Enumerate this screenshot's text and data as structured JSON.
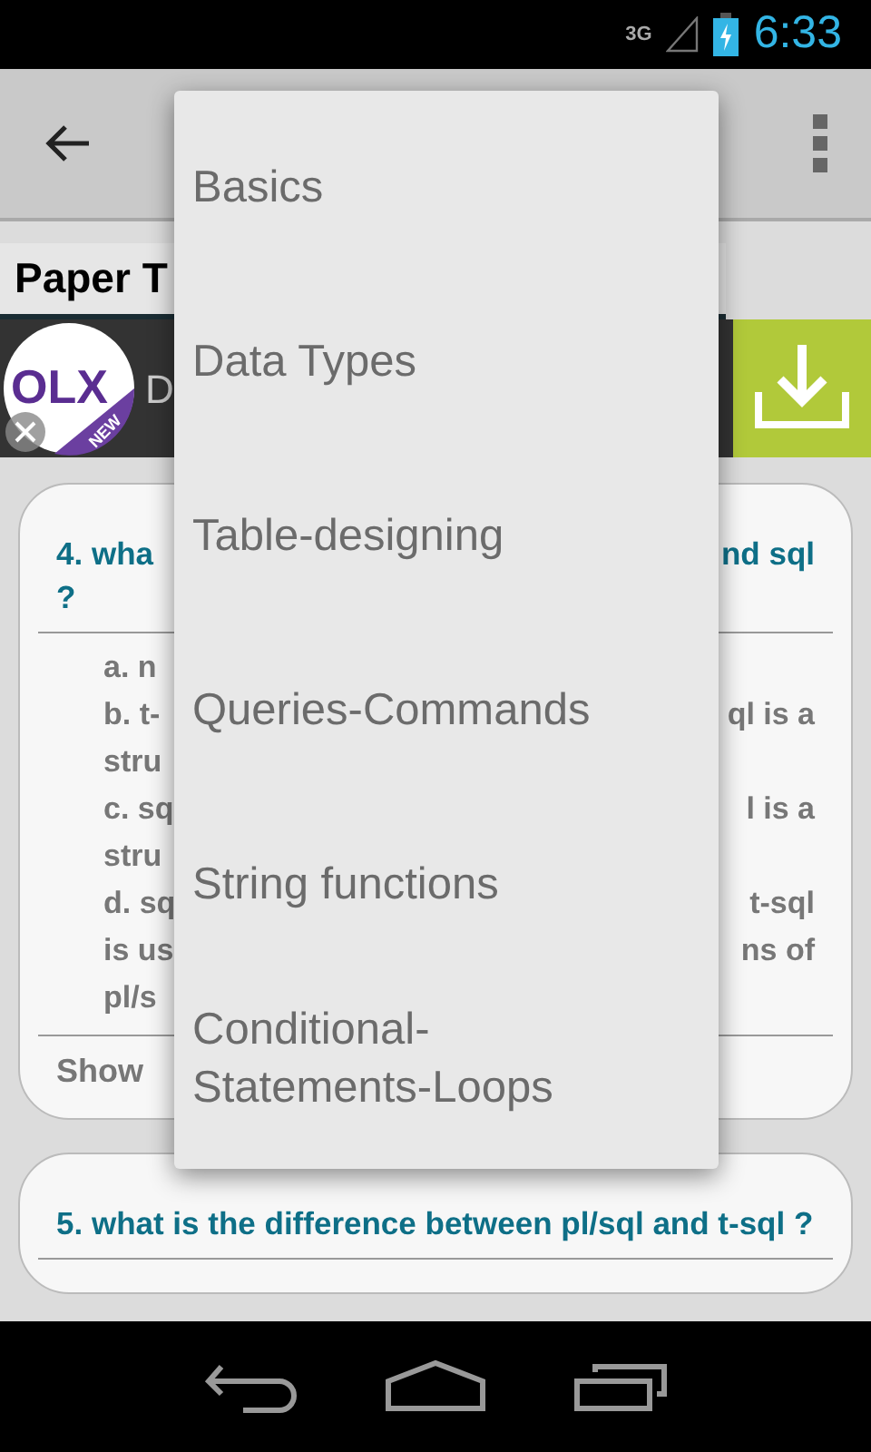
{
  "status_bar": {
    "network": "3G",
    "time": "6:33"
  },
  "tab": {
    "label": "Paper T"
  },
  "ad": {
    "title": "D",
    "brand_lines": [
      "OLX",
      "NEW"
    ]
  },
  "cards": [
    {
      "question_lines": [
        {
          "left": "4. wha",
          "right": "nd sql"
        },
        {
          "left": "?"
        }
      ],
      "option_lines": [
        {
          "left": "a. n"
        },
        {
          "left": "b. t-",
          "right": "ql is a"
        },
        {
          "left": "stru"
        },
        {
          "left": "c. sq",
          "right": "l is a"
        },
        {
          "left": "stru"
        },
        {
          "left": "d. sq",
          "right": "t-sql"
        },
        {
          "left": "is us",
          "right": "ns of"
        },
        {
          "left": "pl/s"
        }
      ],
      "footer": "Show"
    },
    {
      "question_lines": [
        {
          "left": "5. what is the difference between pl/sql and t-sql ?"
        }
      ]
    }
  ],
  "menu": {
    "items": [
      {
        "label": "Basics"
      },
      {
        "label": "Data Types"
      },
      {
        "label": "Table-designing"
      },
      {
        "label": "Queries-Commands"
      },
      {
        "label": "String functions"
      },
      {
        "label": "Conditional-Statements-Loops"
      }
    ]
  }
}
